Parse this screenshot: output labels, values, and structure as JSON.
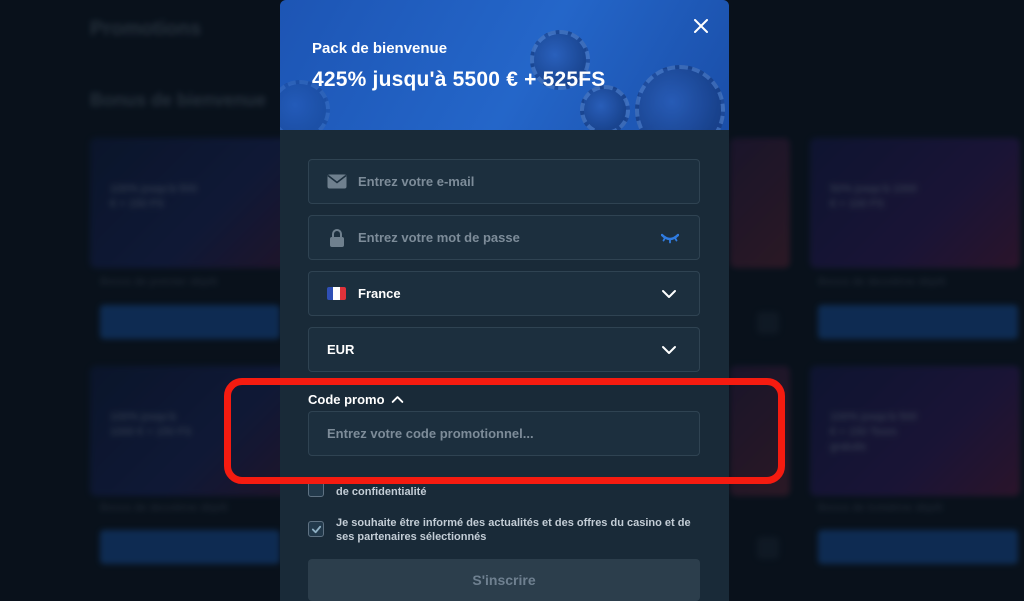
{
  "background": {
    "title": "Promotions",
    "subtitle": "Bonus de bienvenue",
    "cards": [
      {
        "text": "100% jusqu'à 500 € + 150 FS",
        "desc": "Bonus de premier dépôt"
      },
      {
        "text": "100% jusqu'à 1000 € + 150 FS",
        "desc": "Bonus de deuxième dépôt"
      },
      {
        "text": "50% jusqu'à 1000 € + 100 FS",
        "desc": "Bonus de deuxième dépôt"
      },
      {
        "text": "100% jusqu'à 500 € + 150 Tours gratuits",
        "desc": "Bonus de troisième dépôt"
      }
    ]
  },
  "modal": {
    "kicker": "Pack de bienvenue",
    "title": "425% jusqu'à 5500 € + 525FS",
    "email_placeholder": "Entrez votre e-mail",
    "password_placeholder": "Entrez votre mot de passe",
    "country": "France",
    "currency": "EUR",
    "promo_label": "Code promo",
    "promo_placeholder": "Entrez votre code promotionnel...",
    "privacy_text": "de confidentialité",
    "newsletter_text": "Je souhaite être informé des actualités et des offres du casino et de ses partenaires sélectionnés",
    "submit_label": "S'inscrire"
  },
  "colors": {
    "accent": "#2466c9",
    "highlight": "#f51b10",
    "field_bg": "#1c2f3e"
  },
  "icons": [
    "close-icon",
    "mail-icon",
    "lock-icon",
    "eye-icon",
    "france-flag-icon",
    "chevron-down-icon",
    "chevron-up-icon",
    "check-icon"
  ]
}
